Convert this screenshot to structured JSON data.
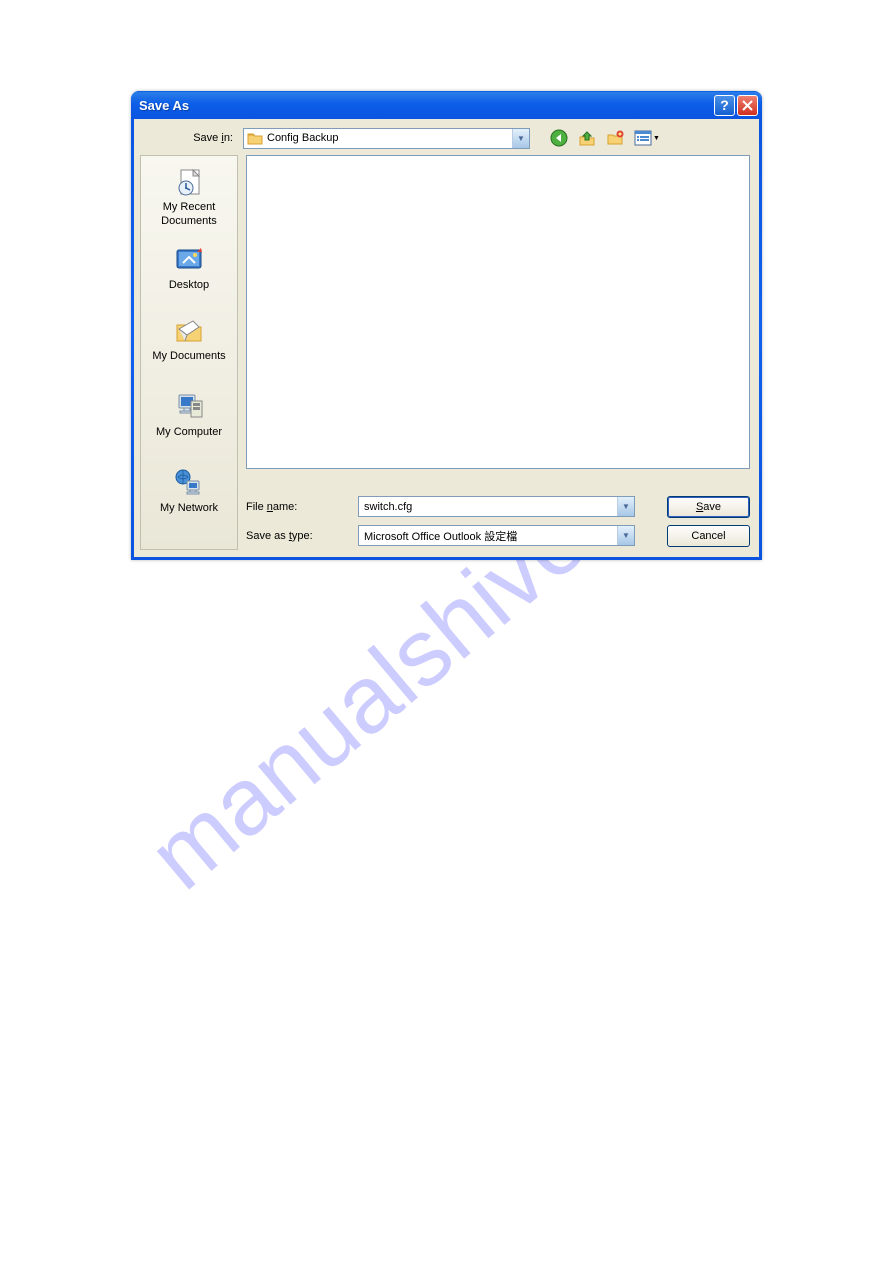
{
  "watermark": "manualshive.com",
  "dialog": {
    "title": "Save As",
    "savein_label": "Save in:",
    "savein_value": "Config Backup",
    "places": [
      {
        "id": "recent",
        "label": "My Recent Documents"
      },
      {
        "id": "desktop",
        "label": "Desktop"
      },
      {
        "id": "mydocs",
        "label": "My Documents"
      },
      {
        "id": "mycomputer",
        "label": "My Computer"
      },
      {
        "id": "mynetwork",
        "label": "My Network"
      }
    ],
    "filename_label": "File name:",
    "filename_value": "switch.cfg",
    "saveastype_label": "Save as type:",
    "saveastype_value": "Microsoft Office Outlook 設定檔",
    "save_button": "Save",
    "cancel_button": "Cancel",
    "toolbar": {
      "back": "Back",
      "up": "Up One Level",
      "newfolder": "Create New Folder",
      "views": "Views"
    }
  }
}
